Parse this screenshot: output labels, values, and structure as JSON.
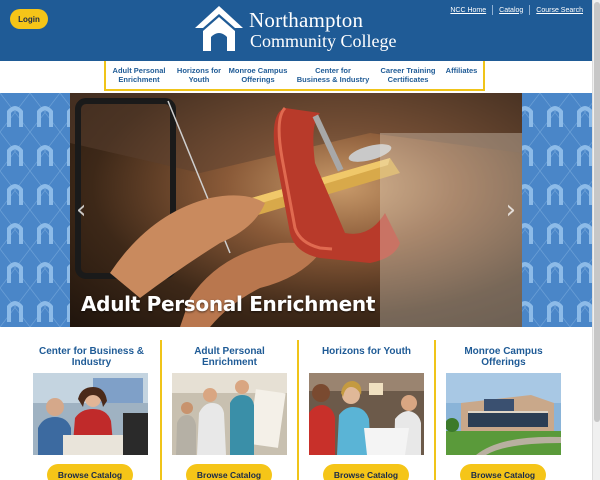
{
  "header": {
    "login_label": "Login",
    "logo_line1": "Northampton",
    "logo_line2": "Community College",
    "util_links": [
      "NCC Home",
      "Catalog",
      "Course Search"
    ]
  },
  "nav": {
    "items": [
      {
        "line1": "Adult Personal",
        "line2": "Enrichment"
      },
      {
        "line1": "Horizons for",
        "line2": "Youth"
      },
      {
        "line1": "Monroe Campus",
        "line2": "Offerings"
      },
      {
        "line1": "Center for",
        "line2": "Business & Industry"
      },
      {
        "line1": "Career Training",
        "line2": "Certificates"
      },
      {
        "line1": "Affiliates",
        "line2": ""
      }
    ]
  },
  "hero": {
    "caption": "Adult Personal Enrichment",
    "prev_icon": "chevron-left-icon",
    "next_icon": "chevron-right-icon"
  },
  "cards": [
    {
      "title": "Center for Business & Industry",
      "button": "Browse Catalog"
    },
    {
      "title": "Adult Personal Enrichment",
      "button": "Browse Catalog"
    },
    {
      "title": "Horizons for Youth",
      "button": "Browse Catalog"
    },
    {
      "title": "Monroe Campus Offerings",
      "button": "Browse Catalog"
    }
  ],
  "colors": {
    "brand_blue": "#1f5b96",
    "accent_yellow": "#f5c518",
    "pattern_blue": "#4a86c8"
  }
}
